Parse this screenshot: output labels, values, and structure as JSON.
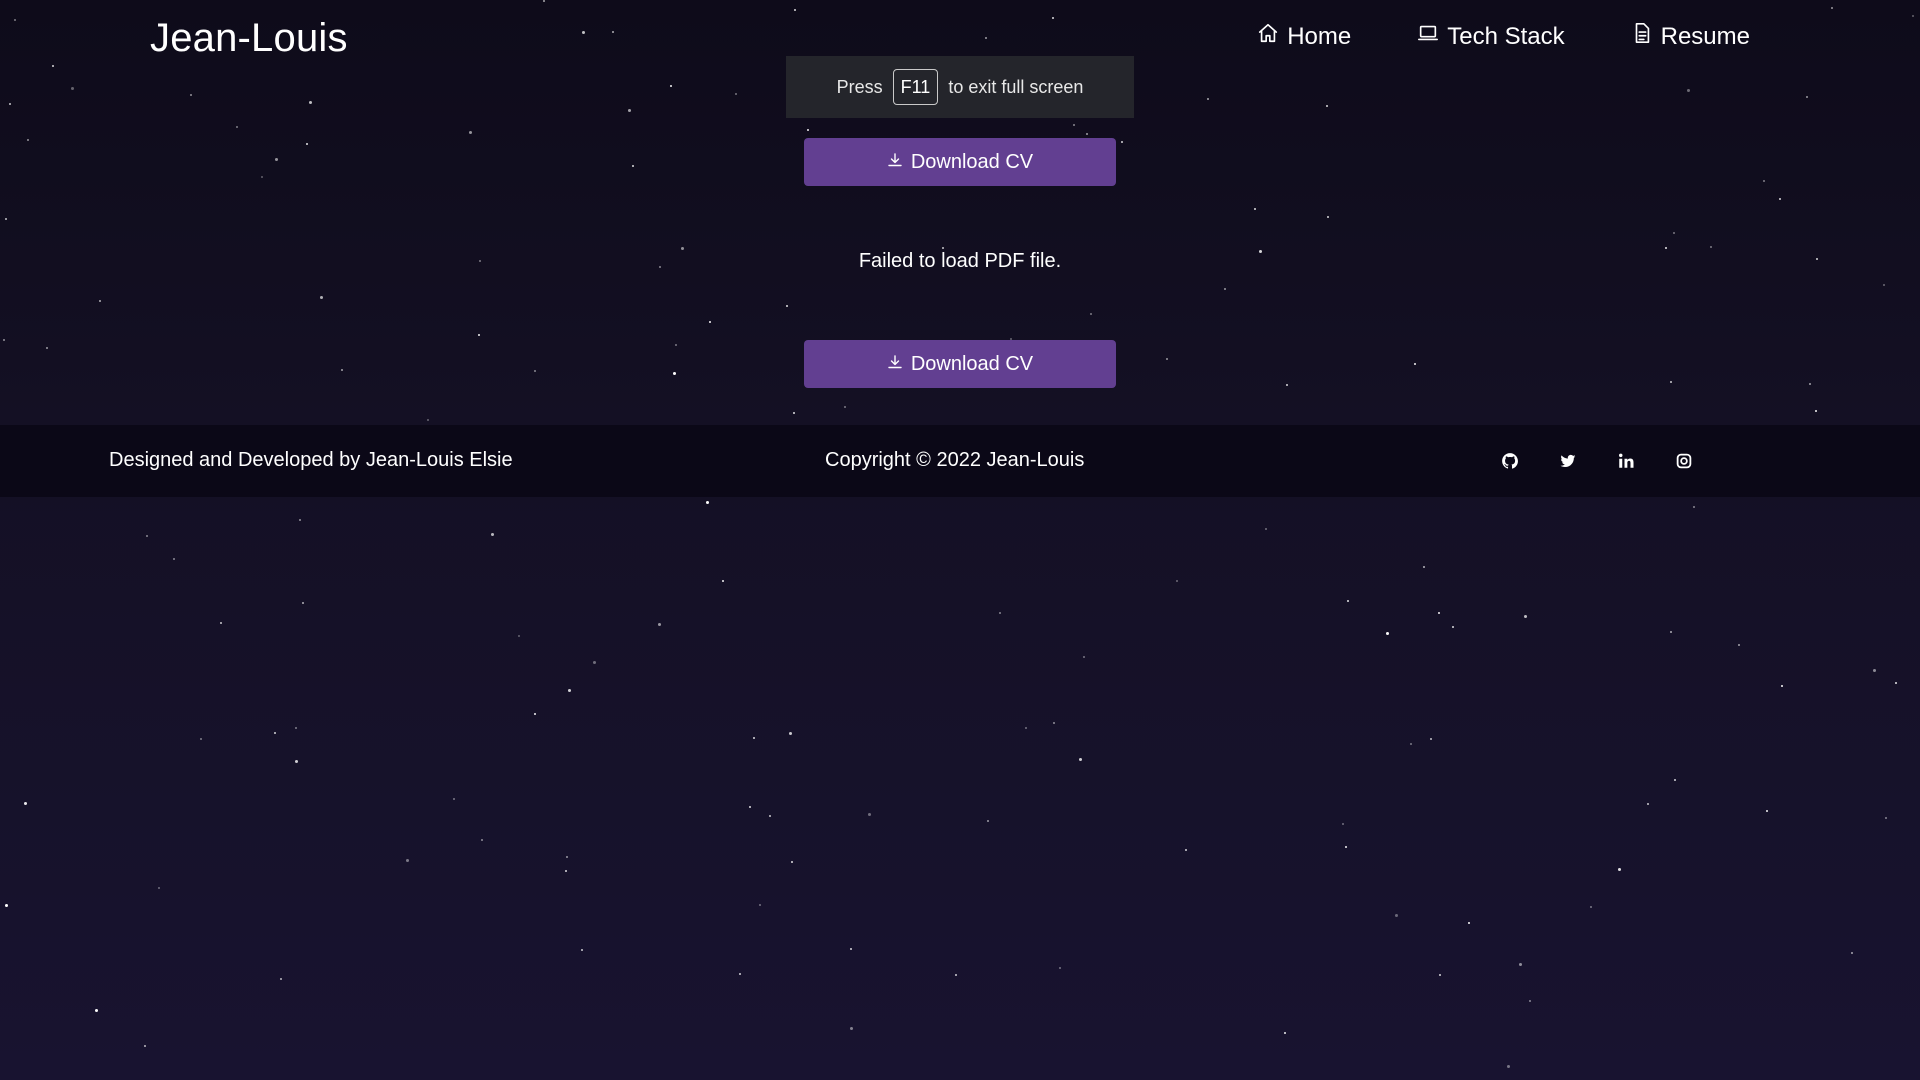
{
  "header": {
    "brand": "Jean-Louis",
    "nav": [
      {
        "label": "Home",
        "icon": "home-icon"
      },
      {
        "label": "Tech Stack",
        "icon": "laptop-icon"
      },
      {
        "label": "Resume",
        "icon": "document-icon"
      }
    ]
  },
  "fullscreen_notice": {
    "prefix": "Press",
    "key": "F11",
    "suffix": "to exit full screen"
  },
  "main": {
    "download_label": "Download CV",
    "download_icon": "download-icon",
    "pdf_error": "Failed to load PDF file."
  },
  "footer": {
    "designed_by": "Designed and Developed by Jean-Louis Elsie",
    "copyright": "Copyright © 2022 Jean-Louis",
    "social": [
      "github-icon",
      "twitter-icon",
      "linkedin-icon",
      "instagram-icon"
    ]
  },
  "colors": {
    "background": "#141024",
    "button": "#623f91",
    "footer": "#0b0817",
    "notice": "#24252b"
  }
}
